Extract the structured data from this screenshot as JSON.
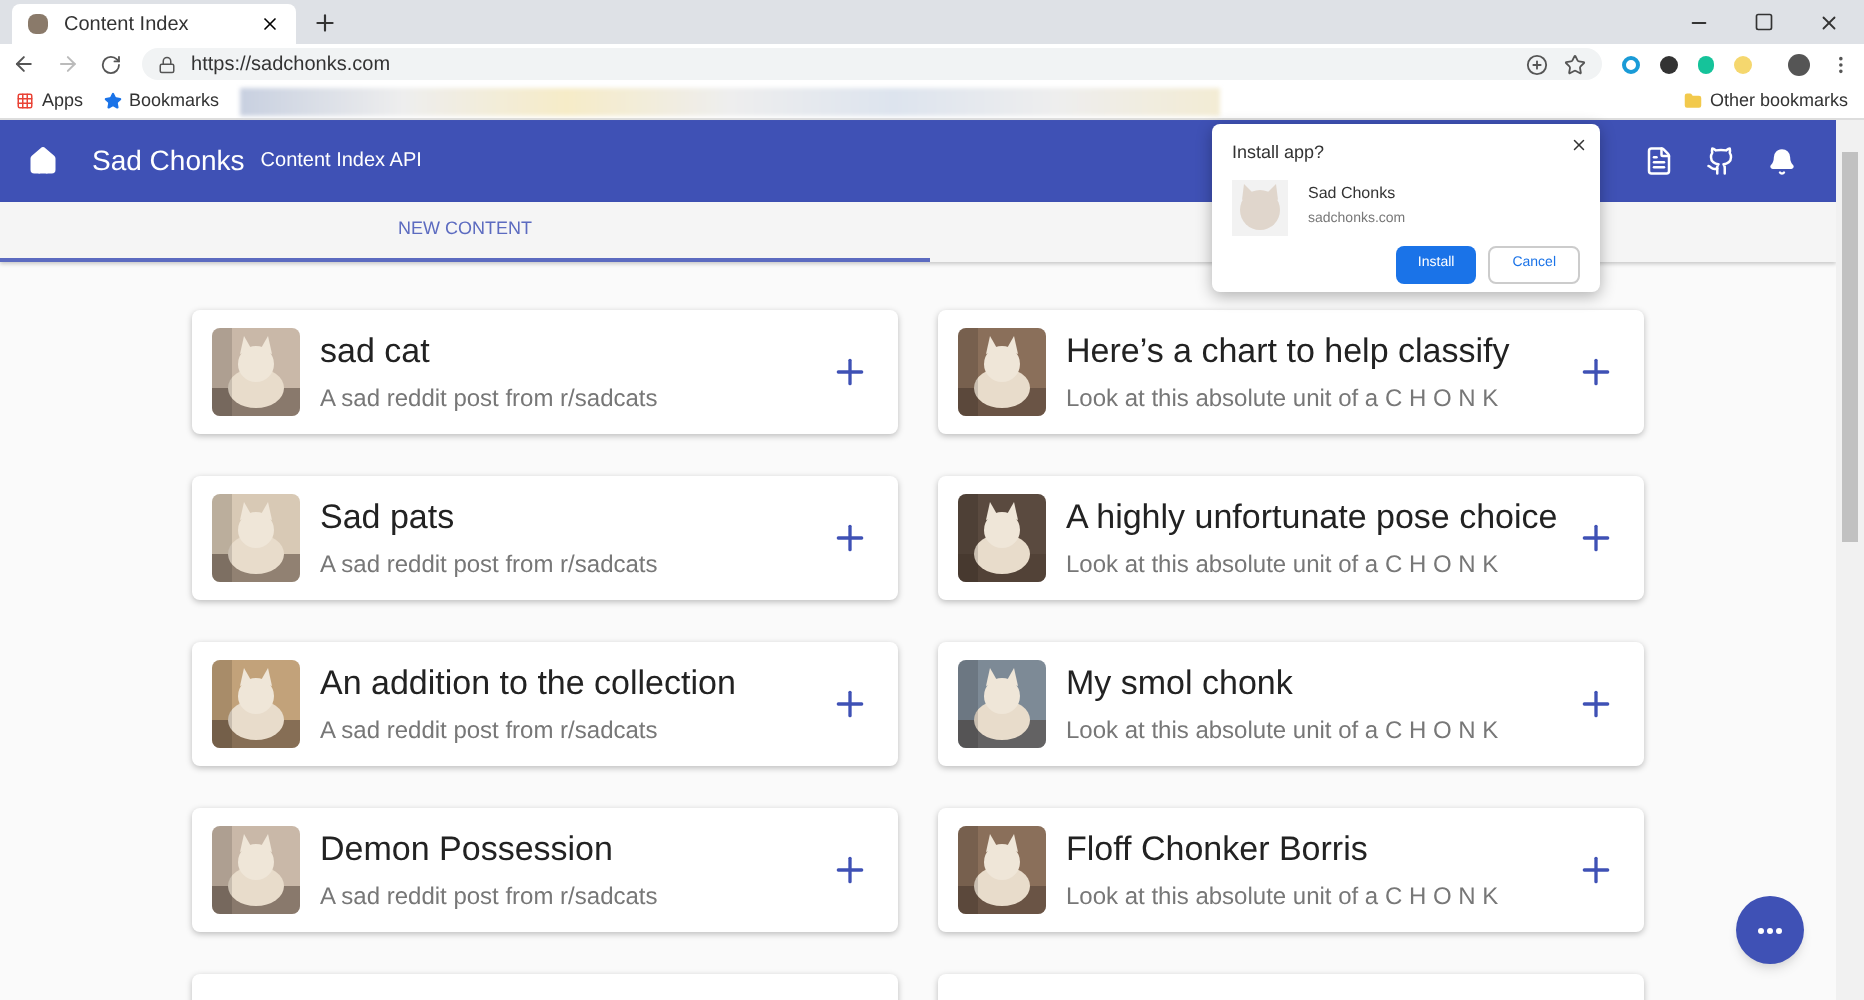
{
  "browser": {
    "tab_title": "Content Index",
    "url": "https://sadchonks.com",
    "bookmarks": [
      {
        "label": "Apps",
        "kind": "apps"
      },
      {
        "label": "Bookmarks",
        "kind": "star"
      }
    ],
    "other_bookmarks": "Other bookmarks"
  },
  "app_bar": {
    "title": "Sad Chonks",
    "subtitle": "Content Index API"
  },
  "tabs": [
    {
      "label": "NEW CONTENT",
      "selected": true
    }
  ],
  "cards": [
    {
      "title": "sad cat",
      "subtitle": "A sad reddit post from r/sadcats"
    },
    {
      "title": "Here’s a chart to help classify",
      "subtitle": "Look at this absolute unit of a C H O N K"
    },
    {
      "title": "Sad pats",
      "subtitle": "A sad reddit post from r/sadcats"
    },
    {
      "title": "A highly unfortunate pose choice",
      "subtitle": "Look at this absolute unit of a C H O N K"
    },
    {
      "title": "An addition to the collection",
      "subtitle": "A sad reddit post from r/sadcats"
    },
    {
      "title": "My smol chonk",
      "subtitle": "Look at this absolute unit of a C H O N K"
    },
    {
      "title": "Demon Possession",
      "subtitle": "A sad reddit post from r/sadcats"
    },
    {
      "title": "Floff Chonker Borris",
      "subtitle": "Look at this absolute unit of a C H O N K"
    }
  ],
  "install_popup": {
    "heading": "Install app?",
    "app_name": "Sad Chonks",
    "domain": "sadchonks.com",
    "buttons": [
      {
        "label": "Install",
        "kind": "primary"
      },
      {
        "label": "Cancel",
        "kind": "secondary"
      }
    ]
  }
}
